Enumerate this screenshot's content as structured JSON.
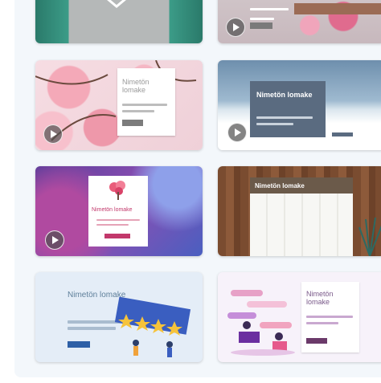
{
  "templates": [
    {
      "id": "t1",
      "has_play": false
    },
    {
      "id": "t2",
      "has_play": true
    },
    {
      "id": "t3",
      "title": "Nimetön lomake",
      "has_play": true
    },
    {
      "id": "t4",
      "title": "Nimetön lomake",
      "has_play": true
    },
    {
      "id": "t5",
      "title": "Nimetön lomake",
      "has_play": true
    },
    {
      "id": "t6",
      "title": "Nimetön lomake",
      "has_play": false
    },
    {
      "id": "t7",
      "title": "Nimetön lomake",
      "has_play": false
    },
    {
      "id": "t8",
      "title": "Nimetön lomake",
      "has_play": false
    }
  ],
  "colors": {
    "panel": "#f3f7fb",
    "accent_pink": "#c2386b",
    "accent_slate": "#5a6b80",
    "accent_blue": "#2d5fa6"
  },
  "icons": [
    "play-icon",
    "chevron-down-icon"
  ]
}
